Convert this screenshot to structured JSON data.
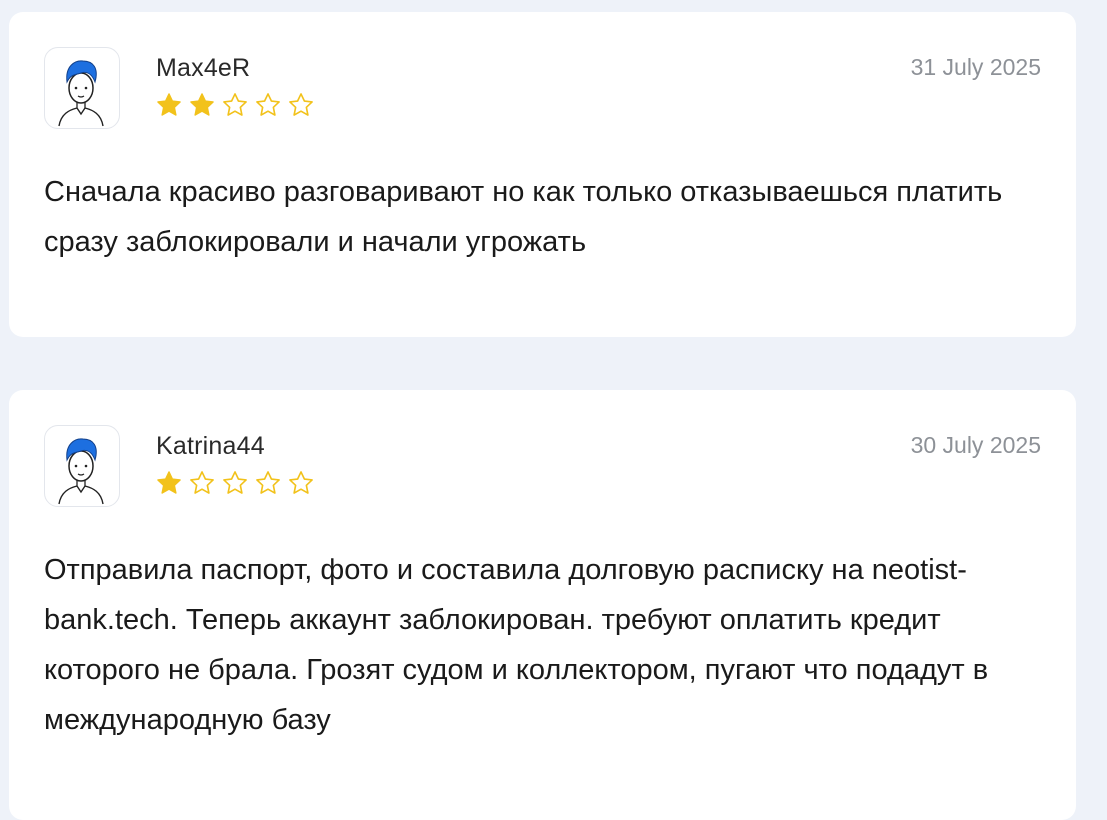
{
  "reviews": [
    {
      "username": "Max4eR",
      "date": "31 July 2025",
      "rating": 2,
      "max_rating": 5,
      "text": "Сначала красиво разговаривают но как только отказываешься платить сразу заблокировали и начали угрожать"
    },
    {
      "username": "Katrina44",
      "date": "30 July 2025",
      "rating": 1,
      "max_rating": 5,
      "text": "Отправила паспорт, фото и составила долговую расписку на neotist-bank.tech. Теперь аккаунт заблокирован. требуют оплатить кредит которого не брала. Грозят судом и коллектором, пугают что подадут в международную базу"
    }
  ],
  "colors": {
    "background": "#eef2f9",
    "card": "#ffffff",
    "star_filled": "#f2c21b",
    "star_empty_stroke": "#f2c21b",
    "date_text": "#8d9197",
    "avatar_hair": "#1d6fe0"
  },
  "icons": {
    "avatar": "user-avatar-icon",
    "star_filled": "star-filled-icon",
    "star_empty": "star-outline-icon"
  }
}
